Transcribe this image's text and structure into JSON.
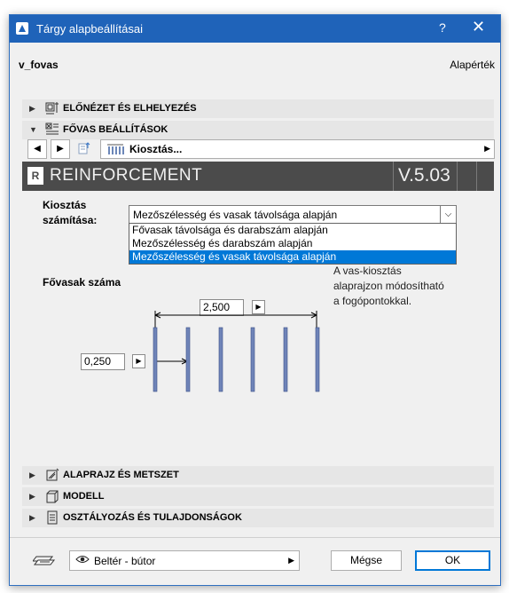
{
  "window": {
    "title": "Tárgy alapbeállításai",
    "help": "?",
    "close": "✕"
  },
  "header": {
    "object_name": "v_fovas",
    "defaults_label": "Alapérték"
  },
  "sections": {
    "preview": "ELŐNÉZET ÉS ELHELYEZÉS",
    "main_bar": "FŐVAS BEÁLLÍTÁSOK",
    "plan": "ALAPRAJZ ÉS METSZET",
    "model": "MODELL",
    "classification": "OSZTÁLYOZÁS ÉS TULAJDONSÁGOK"
  },
  "toolbar": {
    "page_label": "Kiosztás..."
  },
  "banner": {
    "name": "REINFORCEMENT",
    "version": "V.5.03",
    "logo": "R"
  },
  "distribution": {
    "label_line1": "Kiosztás",
    "label_line2": "számítása:",
    "selected": "Mezőszélesség és vasak távolsága alapján",
    "options": [
      "Fővasak távolsága és darabszám alapján",
      "Mezőszélesség és darabszám alapján",
      "Mezőszélesség és vasak távolsága alapján"
    ],
    "selected_index": 2
  },
  "bars": {
    "label": "Fővasak száma",
    "width_value": "2,500",
    "spacing_value": "0,250",
    "hint_line1": "A vas-kiosztás",
    "hint_line2": "alaprajzon módosítható",
    "hint_line3": "a fogópontokkal."
  },
  "footer": {
    "layer": "Beltér - bútor",
    "cancel": "Mégse",
    "ok": "OK"
  },
  "colors": {
    "titlebar": "#1f63b9",
    "banner": "#4b4b4b",
    "selection": "#0078d7"
  }
}
